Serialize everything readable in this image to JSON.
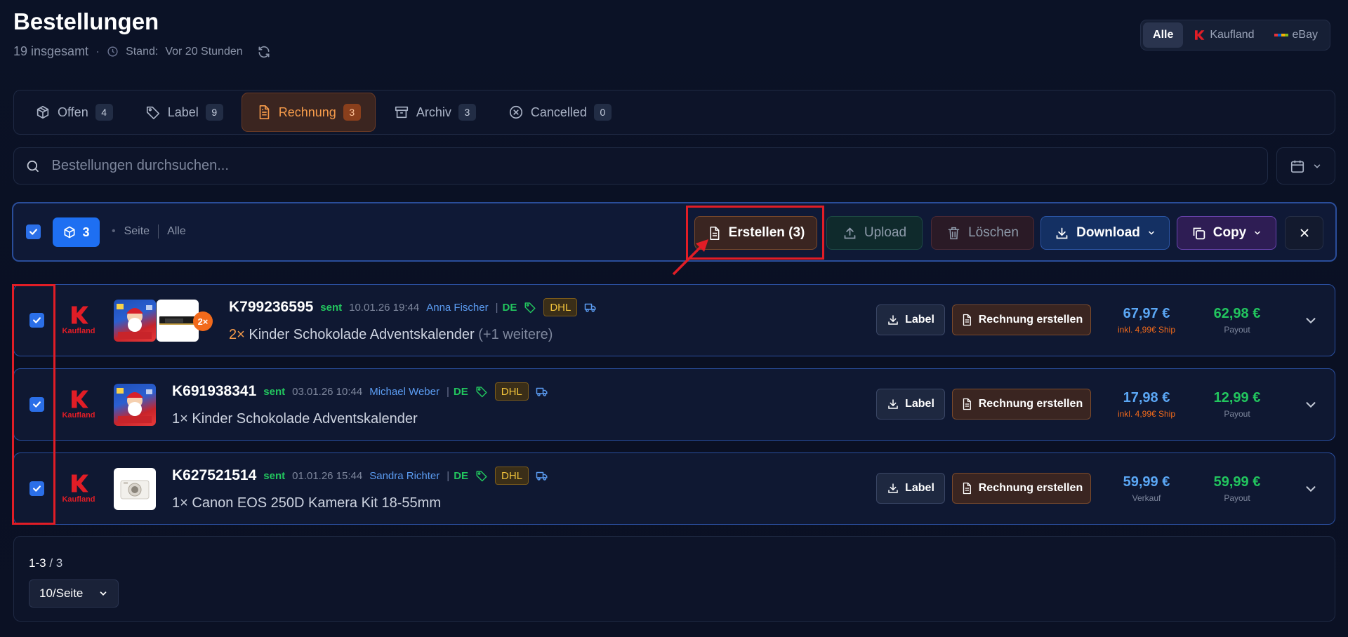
{
  "header": {
    "title": "Bestellungen",
    "total": "19 insgesamt",
    "separator": "·",
    "stand_label": "Stand:",
    "stand_value": "Vor 20 Stunden"
  },
  "marketplace_filter": {
    "options": [
      "Alle",
      "Kaufland",
      "eBay"
    ],
    "selected": "Alle"
  },
  "tabs": [
    {
      "label": "Offen",
      "count": "4",
      "icon": "box-icon"
    },
    {
      "label": "Label",
      "count": "9",
      "icon": "tag-icon"
    },
    {
      "label": "Rechnung",
      "count": "3",
      "icon": "invoice-icon",
      "active": true
    },
    {
      "label": "Archiv",
      "count": "3",
      "icon": "archive-icon"
    },
    {
      "label": "Cancelled",
      "count": "0",
      "icon": "cancel-circle-icon"
    }
  ],
  "search": {
    "placeholder": "Bestellungen durchsuchen..."
  },
  "bulk_bar": {
    "selected_count": "3",
    "seite": "Seite",
    "alle": "Alle",
    "erstellen": "Erstellen (3)",
    "upload": "Upload",
    "loeschen": "Löschen",
    "download": "Download",
    "copy": "Copy"
  },
  "orders": [
    {
      "id": "K799236595",
      "status": "sent",
      "date": "10.01.26 19:44",
      "customer": "Anna Fischer",
      "country": "DE",
      "carrier": "DHL",
      "quantity": "2×",
      "product": "Kinder Schokolade Adventskalender",
      "more": "(+1 weitere)",
      "extra_badge": "2×",
      "price": "67,97 €",
      "price_note": "inkl. 4,99€ Ship",
      "payout": "62,98 €",
      "payout_label": "Payout",
      "label_btn": "Label",
      "invoice_btn": "Rechnung erstellen"
    },
    {
      "id": "K691938341",
      "status": "sent",
      "date": "03.01.26 10:44",
      "customer": "Michael Weber",
      "country": "DE",
      "carrier": "DHL",
      "quantity": "1×",
      "product": "Kinder Schokolade Adventskalender",
      "price": "17,98 €",
      "price_note": "inkl. 4,99€ Ship",
      "payout": "12,99 €",
      "payout_label": "Payout",
      "label_btn": "Label",
      "invoice_btn": "Rechnung erstellen"
    },
    {
      "id": "K627521514",
      "status": "sent",
      "date": "01.01.26 15:44",
      "customer": "Sandra Richter",
      "country": "DE",
      "carrier": "DHL",
      "quantity": "1×",
      "product": "Canon EOS 250D Kamera Kit 18-55mm",
      "price": "59,99 €",
      "price_note": "Verkauf",
      "payout": "59,99 €",
      "payout_label": "Payout",
      "label_btn": "Label",
      "invoice_btn": "Rechnung erstellen"
    }
  ],
  "marketplace_logo_text": "Kaufland",
  "pagination": {
    "range_start": "1-3",
    "range_sep": "/",
    "range_total": "3",
    "page_size": "10/Seite"
  },
  "colors": {
    "accent_orange": "#f59a4a",
    "accent_blue": "#1e6ff2",
    "status_green": "#22c55e",
    "kaufland_red": "#e11d26",
    "annotation_red": "#e11d26"
  }
}
